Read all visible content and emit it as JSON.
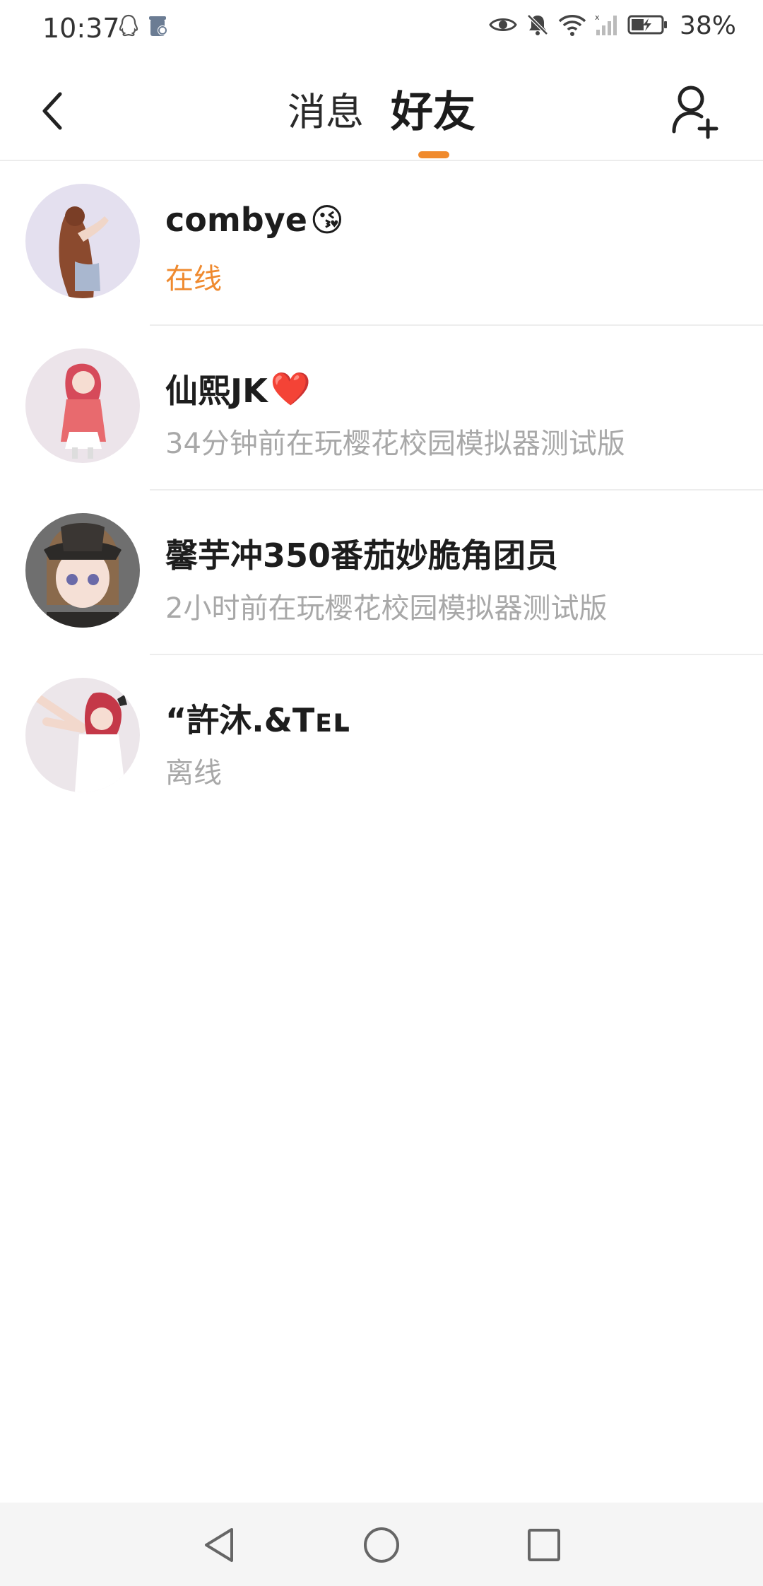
{
  "status_bar": {
    "time": "10:37",
    "battery": "38%",
    "icons": [
      "qq-icon",
      "cleaner-icon",
      "eye-icon",
      "mute-icon",
      "wifi-icon",
      "signal-icon",
      "battery-icon"
    ]
  },
  "header": {
    "tabs": [
      {
        "label": "消息",
        "active": false
      },
      {
        "label": "好友",
        "active": true
      }
    ],
    "accent": "#f08a2c"
  },
  "friends": [
    {
      "name": "combye",
      "emoji": "😘",
      "status": "在线",
      "online": true
    },
    {
      "name": "仙熙JK",
      "emoji": "❤️",
      "status": "34分钟前在玩樱花校园模拟器测试版",
      "online": false
    },
    {
      "name": "馨芋冲350番茄妙脆角团员",
      "emoji": "",
      "status": "2小时前在玩樱花校园模拟器测试版",
      "online": false
    },
    {
      "name": "“許沐.&Tᴇʟ",
      "emoji": "",
      "status": "离线",
      "online": false
    }
  ],
  "colors": {
    "online": "#ef8a2f",
    "muted_text": "#a8a8a8",
    "divider": "#ededed"
  }
}
